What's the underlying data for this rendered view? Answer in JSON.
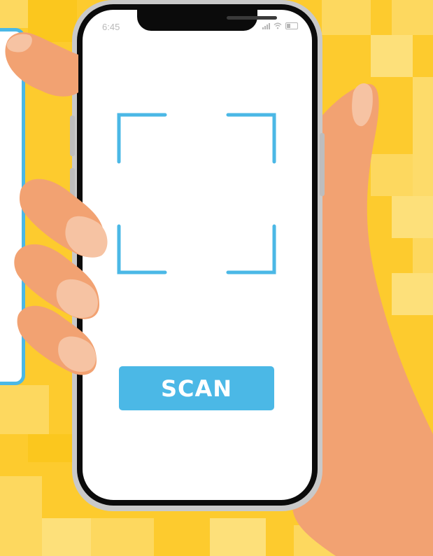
{
  "status_bar": {
    "time": "6:45",
    "icons": [
      "signal-icon",
      "wifi-icon",
      "battery-icon"
    ]
  },
  "scanner": {
    "frame_icon": "scan-frame-icon",
    "button_label": "SCAN"
  },
  "colors": {
    "background": "#FDCB2E",
    "accent": "#4BB8E6",
    "skin": "#F2A272",
    "nail": "#F6C3A3"
  }
}
